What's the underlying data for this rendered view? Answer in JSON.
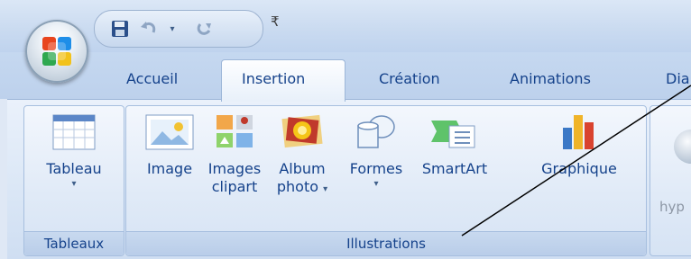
{
  "quick_access": {
    "save_icon": "save-icon",
    "undo_icon": "undo-icon",
    "redo_icon": "redo-icon",
    "customize_label": "₹"
  },
  "tabs": [
    {
      "label": "Accueil"
    },
    {
      "label": "Insertion",
      "active": true
    },
    {
      "label": "Création"
    },
    {
      "label": "Animations"
    },
    {
      "label": "Dia"
    }
  ],
  "groups": {
    "tableaux": {
      "label": "Tableaux",
      "buttons": [
        {
          "label": "Tableau",
          "icon": "table-icon"
        }
      ]
    },
    "illustrations": {
      "label": "Illustrations",
      "buttons": [
        {
          "label": "Image",
          "icon": "image-icon"
        },
        {
          "line1": "Images",
          "line2": "clipart",
          "icon": "clipart-icon"
        },
        {
          "line1": "Album",
          "line2": "photo",
          "icon": "photo-album-icon"
        },
        {
          "label": "Formes",
          "icon": "shapes-icon"
        },
        {
          "label": "SmartArt",
          "icon": "smartart-icon"
        },
        {
          "label": "Graphique",
          "icon": "chart-icon"
        }
      ]
    },
    "partial": {
      "label": "hyp"
    }
  }
}
